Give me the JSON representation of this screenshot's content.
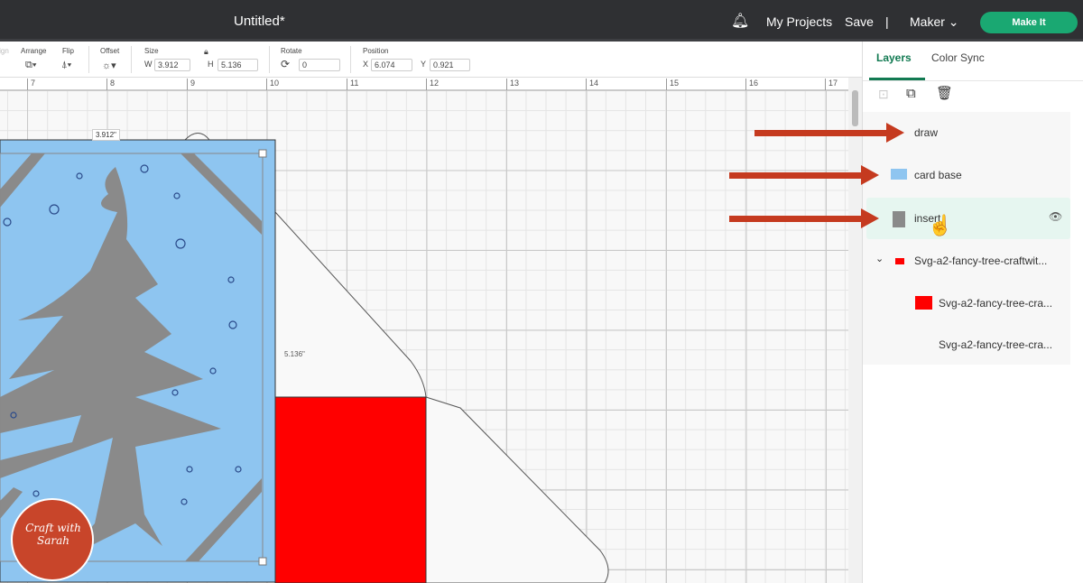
{
  "header": {
    "title": "Untitled*",
    "my_projects": "My Projects",
    "save": "Save",
    "separator": "|",
    "machine": "Maker",
    "make_it": "Make It"
  },
  "toolbar": {
    "align": "Align",
    "arrange": "Arrange",
    "flip": "Flip",
    "offset": "Offset",
    "size": "Size",
    "w_label": "W",
    "w": "3.912",
    "h_label": "H",
    "h": "5.136",
    "rotate": "Rotate",
    "rotate_val": "0",
    "position": "Position",
    "x_label": "X",
    "x": "6.074",
    "y_label": "Y",
    "y": "0.921"
  },
  "ruler": [
    "7",
    "8",
    "9",
    "10",
    "11",
    "12",
    "13",
    "14",
    "15",
    "16",
    "17"
  ],
  "canvas": {
    "width_dim": "3.912\"",
    "height_dim": "5.136\"",
    "logo": "Craft with Sarah"
  },
  "panel": {
    "tabs": [
      "Layers",
      "Color Sync"
    ],
    "layers": [
      {
        "name": "draw"
      },
      {
        "name": "card base",
        "color": "#8ec5f0"
      },
      {
        "name": "insert",
        "color": "#8a8a8a"
      },
      {
        "name": "Svg-a2-fancy-tree-craftwit...",
        "color": "#ff0000"
      },
      {
        "name": "Svg-a2-fancy-tree-cra...",
        "color": "#ff0000"
      },
      {
        "name": "Svg-a2-fancy-tree-cra..."
      }
    ]
  },
  "colors": {
    "accent": "#1aa872",
    "arrow": "#c53a1f",
    "card": "#8ec5f0",
    "tree": "#8a8a8a",
    "red": "#ff0000"
  }
}
